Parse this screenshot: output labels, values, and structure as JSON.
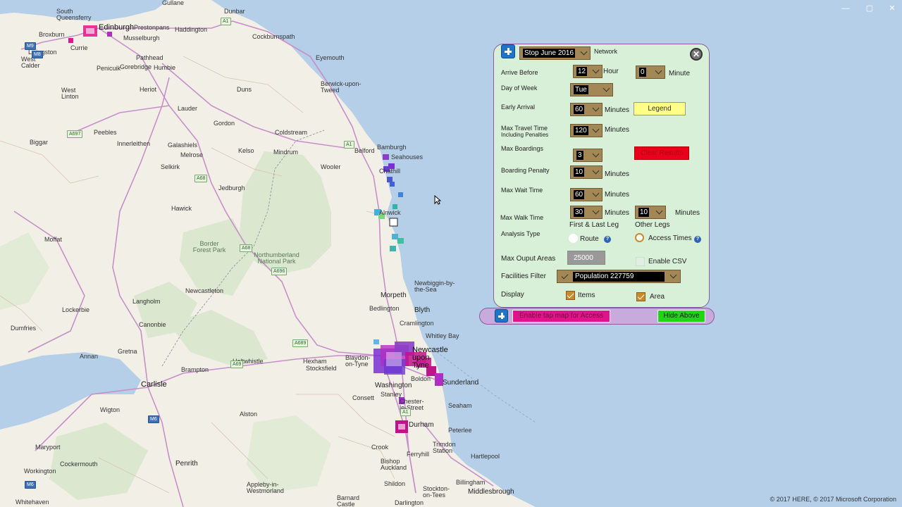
{
  "window": {
    "controls": [
      "—",
      "▢",
      "✕"
    ]
  },
  "map": {
    "copyright": "© 2017 HERE, © 2017 Microsoft Corporation",
    "places": [
      {
        "name": "Gullane"
      },
      {
        "name": "Dunbar"
      },
      {
        "name": "Musselburgh"
      },
      {
        "name": "Prestonpans"
      },
      {
        "name": "Haddington"
      },
      {
        "name": "Edinburgh"
      },
      {
        "name": "South Queensferry"
      },
      {
        "name": "Broxburn"
      },
      {
        "name": "Livingston"
      },
      {
        "name": "Currie"
      },
      {
        "name": "West Calder"
      },
      {
        "name": "Penicuik"
      },
      {
        "name": "Gorebridge"
      },
      {
        "name": "Humbie"
      },
      {
        "name": "Pathhead"
      },
      {
        "name": "Cockburnspath"
      },
      {
        "name": "Eyemouth"
      },
      {
        "name": "Heriot"
      },
      {
        "name": "Duns"
      },
      {
        "name": "Berwick-upon-Tweed"
      },
      {
        "name": "West Linton"
      },
      {
        "name": "Lauder"
      },
      {
        "name": "Gordon"
      },
      {
        "name": "Coldstream"
      },
      {
        "name": "Peebles"
      },
      {
        "name": "Innerleithen"
      },
      {
        "name": "Galashiels"
      },
      {
        "name": "Melrose"
      },
      {
        "name": "Biggar"
      },
      {
        "name": "Kelso"
      },
      {
        "name": "Mindrum"
      },
      {
        "name": "Wooler"
      },
      {
        "name": "Selkirk"
      },
      {
        "name": "Bamburgh"
      },
      {
        "name": "Seahouses"
      },
      {
        "name": "Belford"
      },
      {
        "name": "Chathill"
      },
      {
        "name": "Jedburgh"
      },
      {
        "name": "Hawick"
      },
      {
        "name": "Alnwick"
      },
      {
        "name": "Moffat"
      },
      {
        "name": "Border Forest Park"
      },
      {
        "name": "Northumberland National Park"
      },
      {
        "name": "Newcastleton"
      },
      {
        "name": "Langholm"
      },
      {
        "name": "Lockerbie"
      },
      {
        "name": "Morpeth"
      },
      {
        "name": "Newbiggin-by-the-Sea"
      },
      {
        "name": "Bedlington"
      },
      {
        "name": "Blyth"
      },
      {
        "name": "Dumfries"
      },
      {
        "name": "Canonbie"
      },
      {
        "name": "Cramlington"
      },
      {
        "name": "Whitley Bay"
      },
      {
        "name": "Annan"
      },
      {
        "name": "Gretna"
      },
      {
        "name": "Haltwhistle"
      },
      {
        "name": "Hexham"
      },
      {
        "name": "Stocksfield"
      },
      {
        "name": "Blaydon-on-Tyne"
      },
      {
        "name": "Newcastle upon Tyne"
      },
      {
        "name": "Brampton"
      },
      {
        "name": "Carlisle"
      },
      {
        "name": "Washington"
      },
      {
        "name": "Sunderland"
      },
      {
        "name": "Boldon"
      },
      {
        "name": "Consett"
      },
      {
        "name": "Stanley"
      },
      {
        "name": "Chester-le-Street"
      },
      {
        "name": "Seaham"
      },
      {
        "name": "Wigton"
      },
      {
        "name": "Alston"
      },
      {
        "name": "Durham"
      },
      {
        "name": "Peterlee"
      },
      {
        "name": "Maryport"
      },
      {
        "name": "Crook"
      },
      {
        "name": "Trimdon Station"
      },
      {
        "name": "Cockermouth"
      },
      {
        "name": "Penrith"
      },
      {
        "name": "Bishop Auckland"
      },
      {
        "name": "Ferryhill"
      },
      {
        "name": "Hartlepool"
      },
      {
        "name": "Workington"
      },
      {
        "name": "Appleby-in-Westmorland"
      },
      {
        "name": "Shildon"
      },
      {
        "name": "Billingham"
      },
      {
        "name": "Middlesbrough"
      },
      {
        "name": "Stockton-on-Tees"
      },
      {
        "name": "Whitehaven"
      },
      {
        "name": "Barnard Castle"
      },
      {
        "name": "Darlington"
      }
    ],
    "roads": [
      "M9",
      "M8",
      "A1",
      "A68",
      "A1",
      "A696",
      "A68",
      "M6",
      "A69",
      "A689",
      "A697",
      "A1",
      "M6"
    ]
  },
  "panel": {
    "network_dropdown": "Stop June 2016",
    "network_label": "Network",
    "arrive_before_label": "Arrive Before",
    "arrive_hour": "12",
    "hour_label": "Hour",
    "arrive_minute": "0",
    "minute_label": "Minute",
    "day_of_week_label": "Day of Week",
    "day_of_week": "Tue",
    "early_arrival_label": "Early Arrival",
    "early_arrival": "60",
    "minutes_label": "Minutes",
    "legend_button": "Legend",
    "max_travel_label_1": "Max Travel Time",
    "max_travel_label_2": "Including Penalties",
    "max_travel": "120",
    "max_boardings_label": "Max Boardings",
    "max_boardings": "3",
    "clear_results_button": "Clear Results",
    "boarding_penalty_label": "Boarding Penalty",
    "boarding_penalty": "10",
    "max_wait_label": "Max Wait Time",
    "max_wait": "60",
    "max_walk_label": "Max Walk Time",
    "max_walk_first": "30",
    "max_walk_other": "10",
    "first_last_leg_label": "First  &  Last Leg",
    "other_legs_label": "Other Legs",
    "analysis_type_label": "Analysis Type",
    "route_label": "Route",
    "access_times_label": "Access Times",
    "help_glyph": "?",
    "max_output_label": "Max Ouput Areas",
    "max_output": "25000",
    "enable_csv_label": "Enable CSV",
    "facilities_filter_label": "Facilities  Filter",
    "facilities_filter": "Population 227759",
    "display_label": "Display",
    "items_label": "Items",
    "area_label": "Area",
    "close_glyph": "✕"
  },
  "bottombar": {
    "enable_tap_button": "Enable tap map for Access",
    "hide_above_button": "Hide Above"
  }
}
